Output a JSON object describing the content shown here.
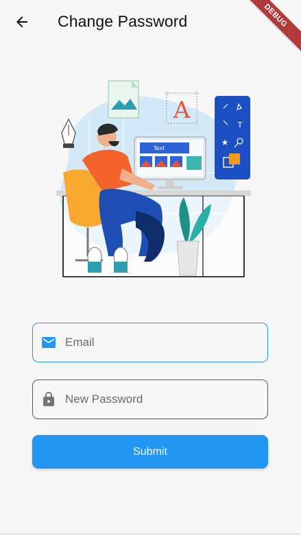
{
  "appbar": {
    "title": "Change Password",
    "back_icon": "arrow-back-icon"
  },
  "debug_banner": {
    "label": "DEBUG",
    "color": "#b23a3a"
  },
  "illustration": {
    "text_label": "Text",
    "letter_label": "A"
  },
  "form": {
    "email": {
      "placeholder": "Email",
      "value": "",
      "icon": "mail-icon",
      "border_color": "#2196f3"
    },
    "new_password": {
      "placeholder": "New Password",
      "value": "",
      "icon": "lock-icon",
      "border_color": "#555555"
    },
    "submit_label": "Submit"
  },
  "colors": {
    "accent": "#2196f3",
    "background": "#f7f7f7"
  }
}
